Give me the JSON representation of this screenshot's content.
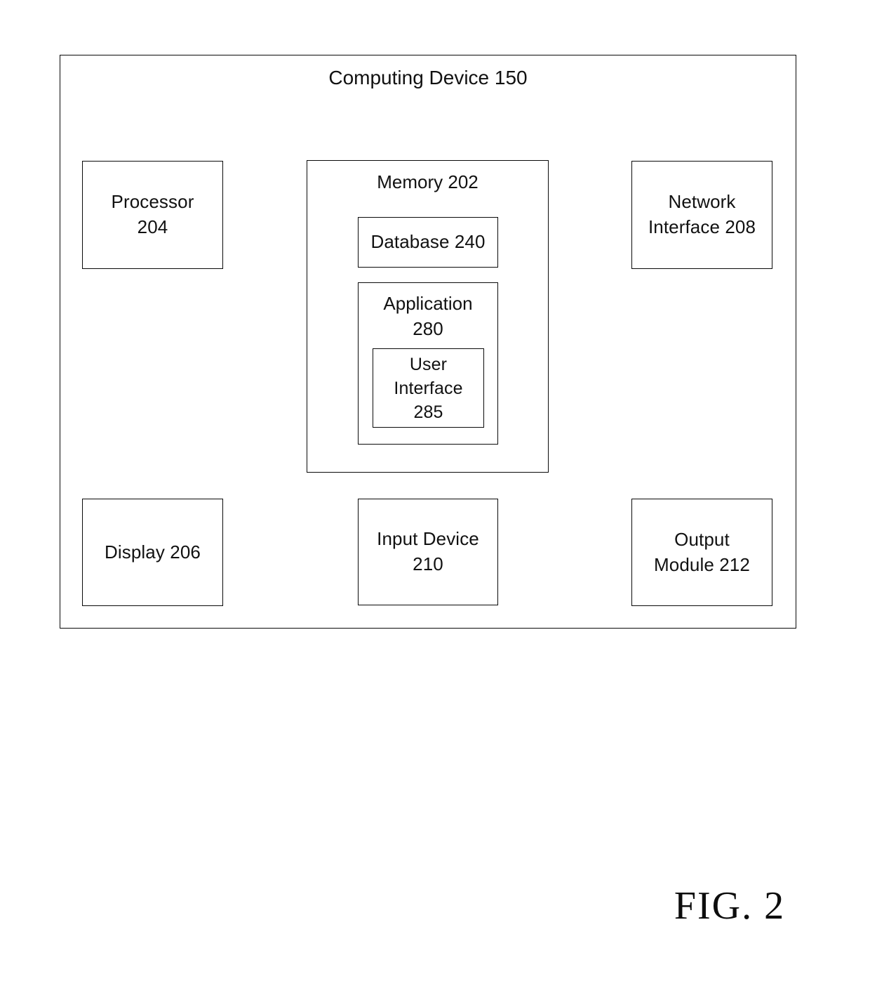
{
  "figure": {
    "caption": "FIG. 2"
  },
  "device": {
    "title": "Computing Device 150",
    "components": {
      "processor": {
        "label": "Processor\n204"
      },
      "network_interface": {
        "label": "Network\nInterface 208"
      },
      "memory": {
        "title": "Memory 202",
        "database": {
          "label": "Database 240"
        },
        "application": {
          "title": "Application\n280",
          "user_interface": {
            "label": "User\nInterface\n285"
          }
        }
      },
      "display": {
        "label": "Display 206"
      },
      "input_device": {
        "label": "Input Device\n210"
      },
      "output_module": {
        "label": "Output\nModule 212"
      }
    }
  },
  "style": {
    "background": "#ffffff",
    "line_color": "#0a0a0a",
    "text_color": "#111111"
  }
}
